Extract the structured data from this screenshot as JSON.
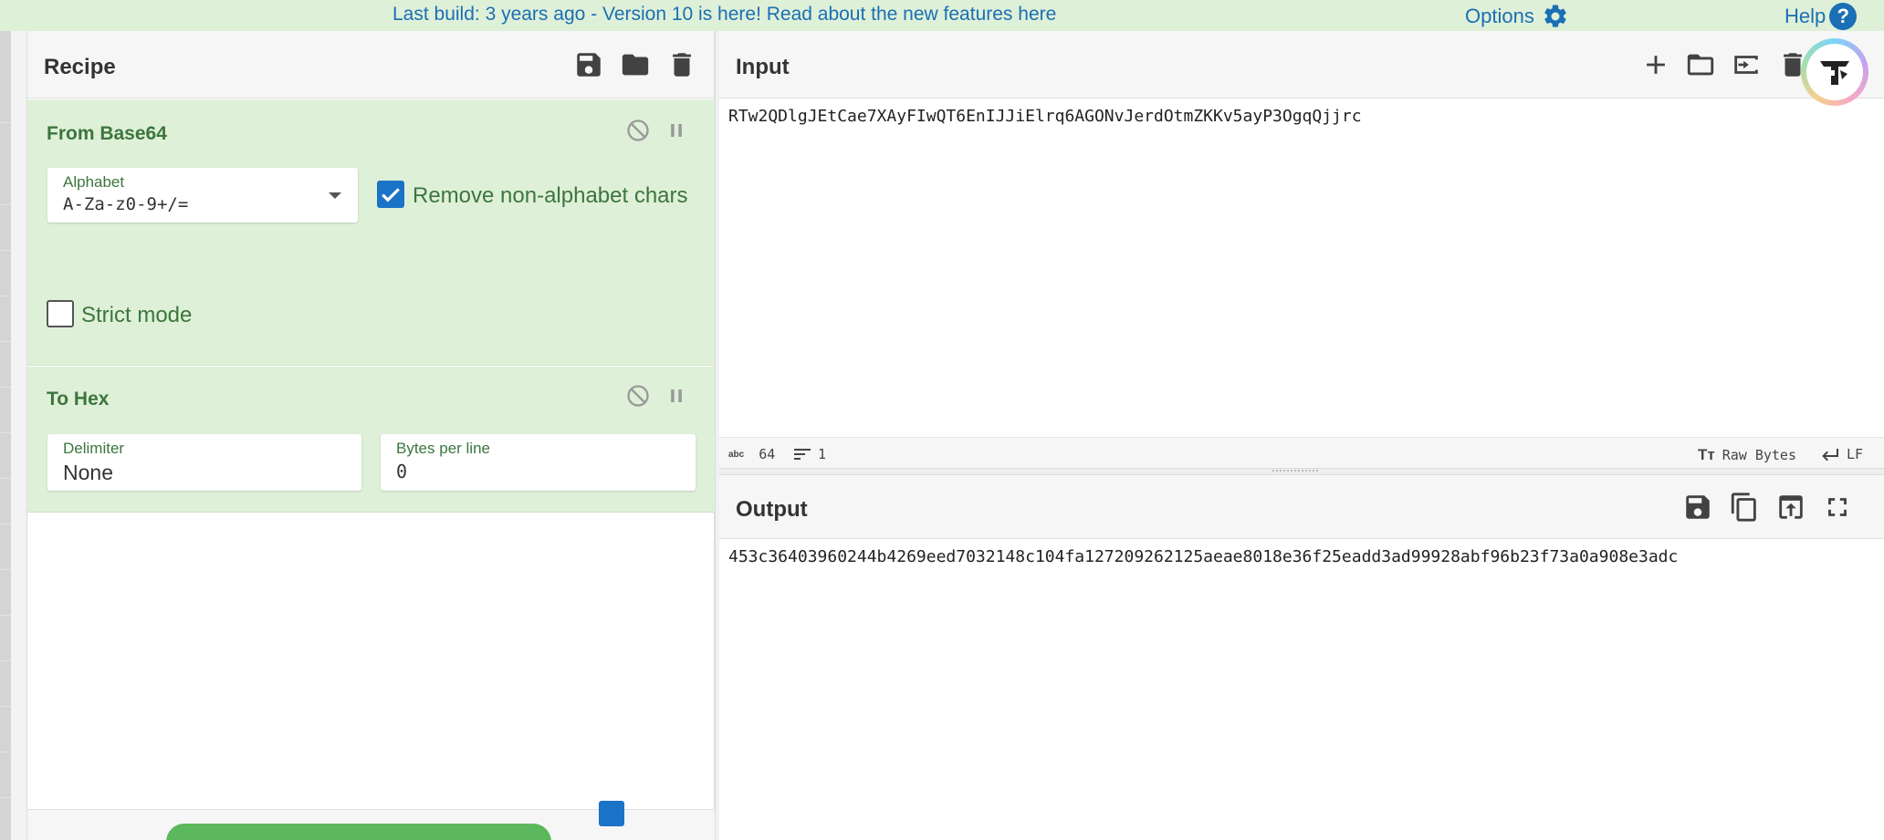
{
  "banner": {
    "text": "Last build: 3 years ago - Version 10 is here! Read about the new features here",
    "options_label": "Options",
    "help_label": "Help",
    "help_glyph": "?"
  },
  "recipe": {
    "title": "Recipe",
    "operations": [
      {
        "title": "From Base64",
        "alphabet_label": "Alphabet",
        "alphabet_value": "A-Za-z0-9+/=",
        "remove_label": "Remove non-alphabet chars",
        "remove_checked": true,
        "strict_label": "Strict mode",
        "strict_checked": false
      },
      {
        "title": "To Hex",
        "delimiter_label": "Delimiter",
        "delimiter_value": "None",
        "bytes_label": "Bytes per line",
        "bytes_value": "0"
      }
    ]
  },
  "input": {
    "title": "Input",
    "text": "RTw2QDlgJEtCae7XAyFIwQT6EnIJJiElrq6AGONvJerdOtmZKKv5ayP3OgqQjjrc",
    "status": {
      "char_icon": "abc",
      "length": "64",
      "lines": "1",
      "format": "Raw Bytes",
      "eol": "LF"
    }
  },
  "output": {
    "title": "Output",
    "text": "453c36403960244b4269eed7032148c104fa127209262125aeae8018e36f25eadd3ad99928abf96b23f73a0a908e3adc"
  },
  "colors": {
    "accent": "#1a6fb5",
    "op_bg": "#dff0d8",
    "op_text": "#3c763d",
    "bake": "#5cb85c"
  }
}
